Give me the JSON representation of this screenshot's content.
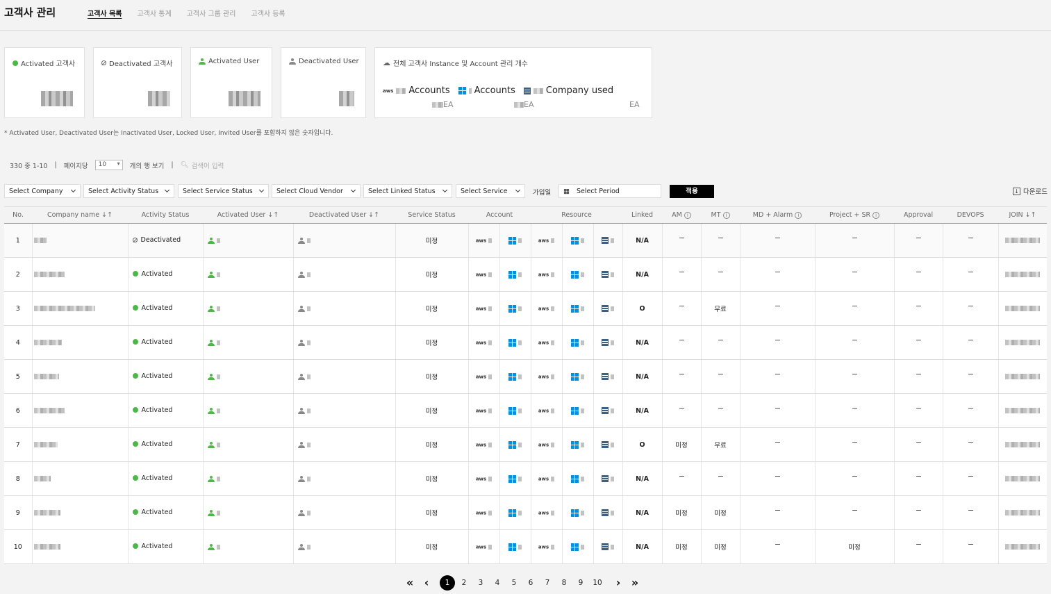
{
  "header": {
    "title": "고객사 관리",
    "tabs": [
      "고객사 목록",
      "고객사 통계",
      "고객사 그룹 관리",
      "고객사 등록"
    ],
    "active_tab": 0
  },
  "cards": {
    "activated_company": "Activated 고객사",
    "deactivated_company": "Deactivated 고객사",
    "activated_user": "Activated User",
    "deactivated_user": "Deactivated User",
    "total_label": "전체 고객사 Instance 및 Account 관리 개수",
    "aws_accounts": "Accounts",
    "azure_accounts": "Accounts",
    "company_used": "Company used",
    "ea_suffix": "EA"
  },
  "note": "* Activated User, Deactivated User는 Inactivated User, Locked User, Invited User를 포함하지 않은 숫자입니다.",
  "list_bar": {
    "range": "330 중 1-10",
    "per_page_label": "페이지당",
    "per_page": "10",
    "rows_label": "개의 행 보기",
    "search_placeholder": "검색어 입력"
  },
  "filters": {
    "company": "Select Company",
    "activity": "Select Activity Status",
    "service_status": "Select Service Status",
    "cloud_vendor": "Select Cloud Vendor",
    "linked": "Select Linked Status",
    "service": "Select Service",
    "join_label": "가입일",
    "period": "Select Period",
    "apply": "적용",
    "download": "다운로드"
  },
  "table": {
    "headers": {
      "no": "No.",
      "company": "Company name ↓↑",
      "activity": "Activity Status",
      "act_user": "Activated User ↓↑",
      "deact_user": "Deactivated User ↓↑",
      "service_status": "Service Status",
      "account": "Account",
      "resource": "Resource",
      "linked": "Linked",
      "am": "AM",
      "mt": "MT",
      "md": "MD + Alarm",
      "project": "Project + SR",
      "approval": "Approval",
      "devops": "DEVOPS",
      "join": "JOIN ↓↑"
    },
    "rows": [
      {
        "no": "1",
        "status": "Deactivated",
        "service": "미정",
        "linked": "N/A",
        "am": "",
        "mt": "",
        "project": ""
      },
      {
        "no": "2",
        "status": "Activated",
        "service": "미정",
        "linked": "N/A",
        "am": "",
        "mt": "",
        "project": ""
      },
      {
        "no": "3",
        "status": "Activated",
        "service": "미정",
        "linked": "O",
        "am": "",
        "mt": "무료",
        "project": ""
      },
      {
        "no": "4",
        "status": "Activated",
        "service": "미정",
        "linked": "N/A",
        "am": "",
        "mt": "",
        "project": ""
      },
      {
        "no": "5",
        "status": "Activated",
        "service": "미정",
        "linked": "N/A",
        "am": "",
        "mt": "",
        "project": ""
      },
      {
        "no": "6",
        "status": "Activated",
        "service": "미정",
        "linked": "N/A",
        "am": "",
        "mt": "",
        "project": ""
      },
      {
        "no": "7",
        "status": "Activated",
        "service": "미정",
        "linked": "O",
        "am": "미정",
        "mt": "무료",
        "project": ""
      },
      {
        "no": "8",
        "status": "Activated",
        "service": "미정",
        "linked": "N/A",
        "am": "",
        "mt": "",
        "project": ""
      },
      {
        "no": "9",
        "status": "Activated",
        "service": "미정",
        "linked": "N/A",
        "am": "미정",
        "mt": "미정",
        "project": ""
      },
      {
        "no": "10",
        "status": "Activated",
        "service": "미정",
        "linked": "N/A",
        "am": "미정",
        "mt": "미정",
        "project": "미정"
      }
    ]
  },
  "pagination": {
    "pages": [
      "1",
      "2",
      "3",
      "4",
      "5",
      "6",
      "7",
      "8",
      "9",
      "10"
    ],
    "current": "1"
  },
  "colors": {
    "accent": "#000000",
    "active_green": "#4db848",
    "azure_blue": "#0a8ed9"
  }
}
